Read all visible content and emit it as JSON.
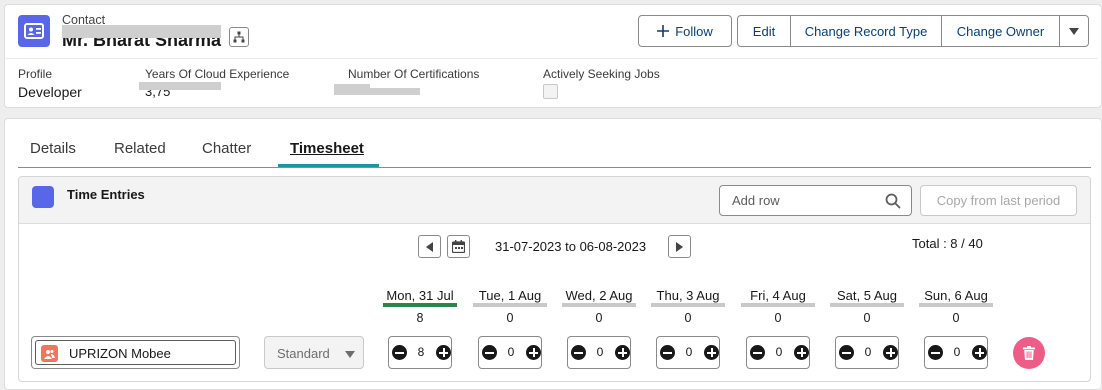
{
  "record": {
    "object_label": "Contact",
    "name": "Mr. Bharat Sharma"
  },
  "actions": {
    "follow": "Follow",
    "edit": "Edit",
    "change_record_type": "Change Record Type",
    "change_owner": "Change Owner"
  },
  "highlights": {
    "profile_label": "Profile",
    "profile_value": "Developer",
    "experience_label": "Years Of Cloud Experience",
    "experience_value": "3,75",
    "certifications_label": "Number Of Certifications",
    "seeking_label": "Actively Seeking Jobs"
  },
  "tabs": [
    "Details",
    "Related",
    "Chatter",
    "Timesheet"
  ],
  "active_tab": "Timesheet",
  "timesheet": {
    "title": "Time Entries",
    "search_placeholder": "Add row",
    "copy_label": "Copy from last period",
    "date_range": "31-07-2023 to 06-08-2023",
    "total": "Total : 8 / 40",
    "days": [
      {
        "label": "Mon, 31 Jul",
        "total": "8",
        "active": true
      },
      {
        "label": "Tue, 1 Aug",
        "total": "0",
        "active": false
      },
      {
        "label": "Wed, 2 Aug",
        "total": "0",
        "active": false
      },
      {
        "label": "Thu, 3 Aug",
        "total": "0",
        "active": false
      },
      {
        "label": "Fri, 4 Aug",
        "total": "0",
        "active": false
      },
      {
        "label": "Sat, 5 Aug",
        "total": "0",
        "active": false
      },
      {
        "label": "Sun, 6 Aug",
        "total": "0",
        "active": false
      }
    ],
    "row": {
      "project": "UPRIZON Mobee",
      "type": "Standard",
      "hours": [
        "8",
        "0",
        "0",
        "0",
        "0",
        "0",
        "0"
      ]
    }
  },
  "colors": {
    "brand": "#5867e8",
    "active_day": "#2e844a",
    "tab_underline": "#1b96a1",
    "delete": "#ee5d88",
    "project_icon": "#ef7561"
  },
  "icons": {
    "record": "contact-card-icon",
    "hierarchy": "hierarchy-icon",
    "follow": "plus-icon",
    "more": "chevron-down-icon",
    "search": "search-icon",
    "calendar": "calendar-icon",
    "prev": "triangle-left-icon",
    "next": "triangle-right-icon",
    "project": "people-icon",
    "delete": "trash-icon"
  }
}
